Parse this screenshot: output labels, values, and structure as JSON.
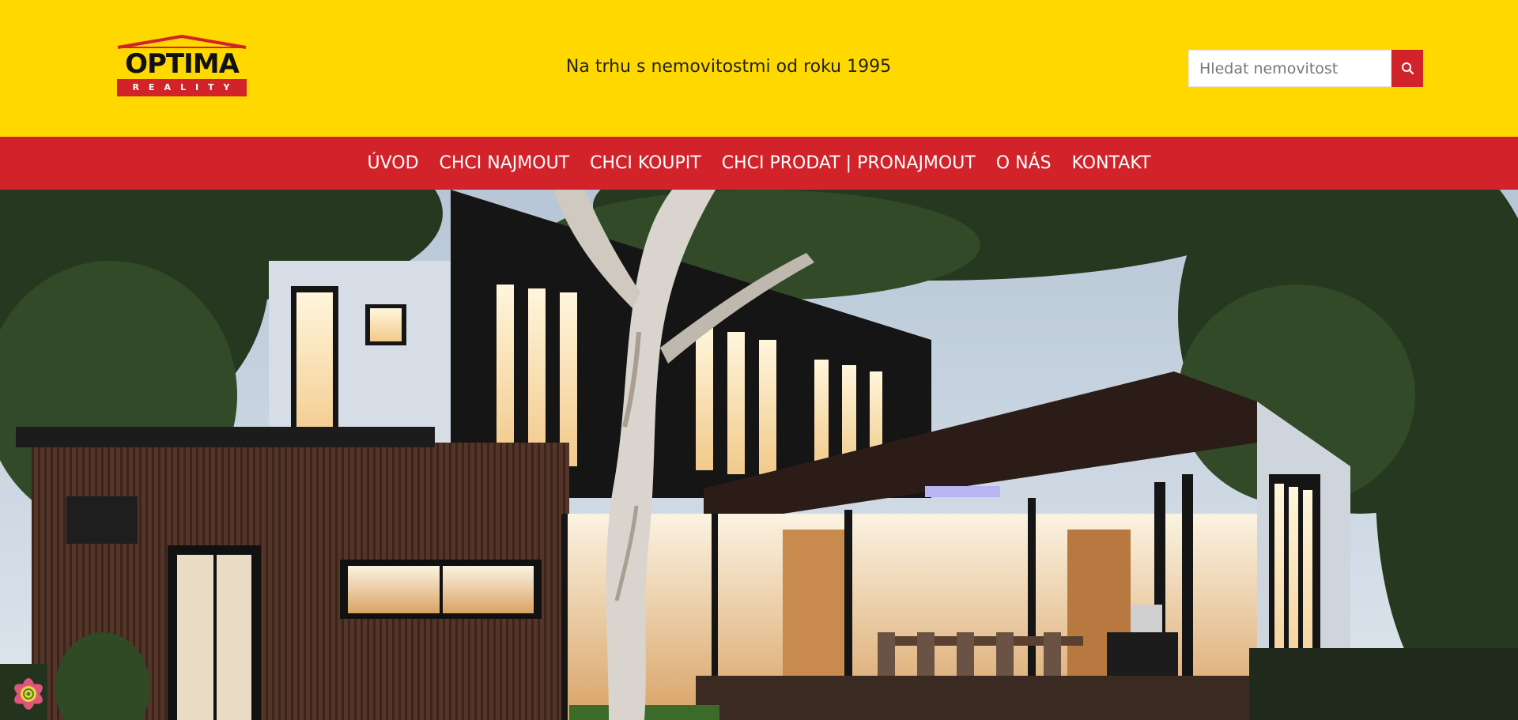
{
  "logo": {
    "name": "OPTIMA",
    "sub": "REALITY"
  },
  "header": {
    "tagline": "Na trhu s nemovitostmi od roku 1995"
  },
  "search": {
    "placeholder": "Hledat nemovitost",
    "icon": "search-icon"
  },
  "nav": {
    "items": [
      {
        "label": "ÚVOD"
      },
      {
        "label": "CHCI NAJMOUT"
      },
      {
        "label": "CHCI KOUPIT"
      },
      {
        "label": "CHCI PRODAT | PRONAJMOUT"
      },
      {
        "label": "O NÁS"
      },
      {
        "label": "KONTAKT"
      }
    ]
  },
  "hero": {
    "icon": "modern-house-photo"
  },
  "widget": {
    "icon": "flower-badge-icon"
  },
  "colors": {
    "brand_yellow": "#FFD800",
    "brand_red": "#D2232A"
  }
}
